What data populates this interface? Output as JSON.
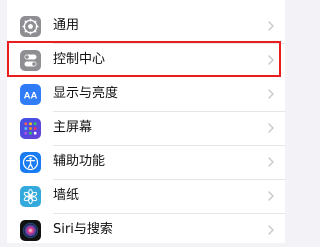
{
  "colors": {
    "page_background": "#f2f2f7",
    "card_background": "#ffffff",
    "highlight_border": "#ea1c1c",
    "chevron": "#c7c7cc",
    "label_text": "#111111"
  },
  "settings": {
    "items": [
      {
        "label": "通用",
        "icon": "gear-icon",
        "highlighted": false
      },
      {
        "label": "控制中心",
        "icon": "control-center-icon",
        "highlighted": true
      },
      {
        "label": "显示与亮度",
        "icon": "aa-text-icon",
        "highlighted": false
      },
      {
        "label": "主屏幕",
        "icon": "home-screen-grid-icon",
        "highlighted": false
      },
      {
        "label": "辅助功能",
        "icon": "accessibility-icon",
        "highlighted": false
      },
      {
        "label": "墙纸",
        "icon": "wallpaper-flower-icon",
        "highlighted": false
      },
      {
        "label": "Siri与搜索",
        "icon": "siri-icon",
        "highlighted": false
      }
    ]
  }
}
